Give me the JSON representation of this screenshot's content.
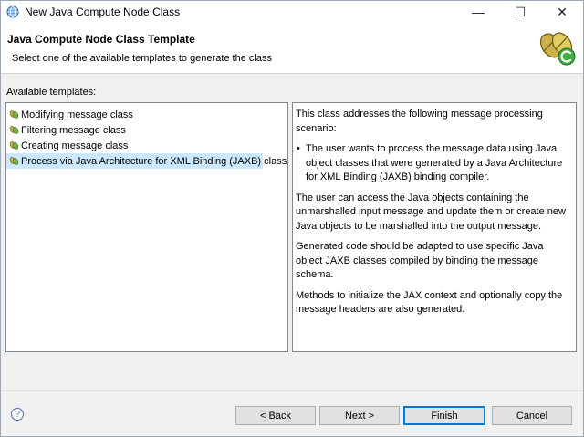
{
  "window": {
    "title": "New Java Compute Node Class",
    "controls": {
      "minimize": "—",
      "maximize": "☐",
      "close": "✕"
    }
  },
  "header": {
    "title": "Java Compute Node Class Template",
    "description": "Select one of the available templates to generate the class"
  },
  "templates": {
    "label": "Available templates:",
    "items": [
      {
        "label": "Modifying message class",
        "selected": false
      },
      {
        "label": "Filtering message class",
        "selected": false
      },
      {
        "label": "Creating message class",
        "selected": false
      },
      {
        "label": "Process via Java Architecture for XML Binding (JAXB) class",
        "selected": true
      }
    ]
  },
  "description": {
    "intro": "This class addresses the following message processing scenario:",
    "bullet": "The user wants to process the message data using Java object classes that were generated by a Java Architecture for XML Binding (JAXB) binding compiler.",
    "para1": "The user can access the Java objects containing the unmarshalled input message and update them or create new Java objects to be marshalled into the output message.",
    "para2": "Generated code should be adapted to use specific Java object JAXB classes compiled by binding the message schema.",
    "para3": "Methods to initialize the JAX context and optionally copy the message headers are also generated."
  },
  "buttons": {
    "help": "?",
    "back": "< Back",
    "next": "Next >",
    "finish": "Finish",
    "cancel": "Cancel"
  },
  "colors": {
    "selection": "#cce8ff",
    "default_button_border": "#0078d7"
  }
}
